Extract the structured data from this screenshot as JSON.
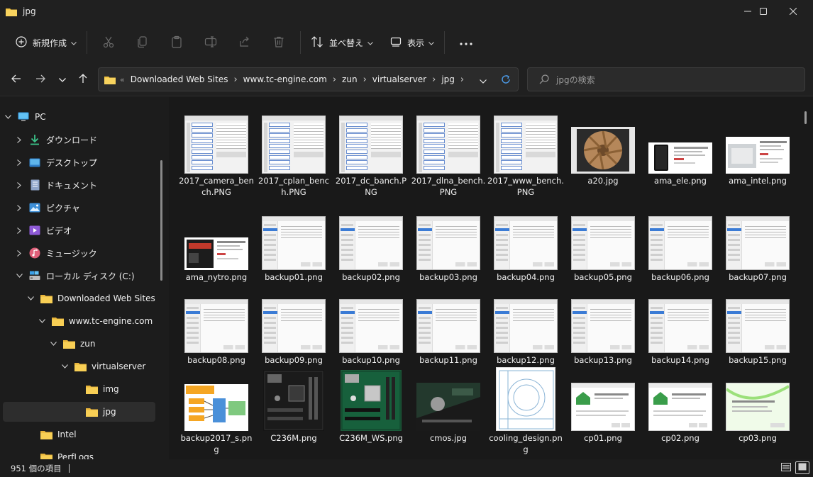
{
  "window": {
    "title": "jpg"
  },
  "toolbar": {
    "new_label": "新規作成",
    "sort_label": "並べ替え",
    "view_label": "表示"
  },
  "address": {
    "crumbs": [
      "Downloaded Web Sites",
      "www.tc-engine.com",
      "zun",
      "virtualserver",
      "jpg"
    ]
  },
  "search": {
    "placeholder": "jpgの検索"
  },
  "sidebar": {
    "items": [
      {
        "label": "PC",
        "icon": "pc-icon",
        "level": 0,
        "expanded": true
      },
      {
        "label": "ダウンロード",
        "icon": "download-icon",
        "level": 1,
        "expanded": false
      },
      {
        "label": "デスクトップ",
        "icon": "desktop-icon",
        "level": 1,
        "expanded": false
      },
      {
        "label": "ドキュメント",
        "icon": "document-icon",
        "level": 1,
        "expanded": false
      },
      {
        "label": "ピクチャ",
        "icon": "picture-icon",
        "level": 1,
        "expanded": false
      },
      {
        "label": "ビデオ",
        "icon": "video-icon",
        "level": 1,
        "expanded": false
      },
      {
        "label": "ミュージック",
        "icon": "music-icon",
        "level": 1,
        "expanded": false
      },
      {
        "label": "ローカル ディスク (C:)",
        "icon": "drive-icon",
        "level": 1,
        "expanded": true
      },
      {
        "label": "Downloaded Web Sites",
        "icon": "folder-icon",
        "level": 2,
        "expanded": true
      },
      {
        "label": "www.tc-engine.com",
        "icon": "folder-icon",
        "level": 3,
        "expanded": true
      },
      {
        "label": "zun",
        "icon": "folder-icon",
        "level": 4,
        "expanded": true
      },
      {
        "label": "virtualserver",
        "icon": "folder-icon",
        "level": 5,
        "expanded": true
      },
      {
        "label": "img",
        "icon": "folder-icon",
        "level": 6,
        "expanded": null
      },
      {
        "label": "jpg",
        "icon": "folder-icon",
        "level": 6,
        "expanded": null,
        "selected": true
      },
      {
        "label": "Intel",
        "icon": "folder-icon",
        "level": 2,
        "expanded": null
      },
      {
        "label": "PerfLogs",
        "icon": "folder-icon",
        "level": 2,
        "expanded": null
      }
    ]
  },
  "files": [
    {
      "name": "2017_camera_bench.PNG",
      "thumb": "bench"
    },
    {
      "name": "2017_cplan_bench.PNG",
      "thumb": "bench"
    },
    {
      "name": "2017_dc_banch.PNG",
      "thumb": "bench"
    },
    {
      "name": "2017_dlna_bench.PNG",
      "thumb": "bench"
    },
    {
      "name": "2017_www_bench.PNG",
      "thumb": "bench"
    },
    {
      "name": "a20.jpg",
      "thumb": "fan"
    },
    {
      "name": "ama_ele.png",
      "thumb": "product-ele"
    },
    {
      "name": "ama_intel.png",
      "thumb": "product-intel"
    },
    {
      "name": "ama_nytro.png",
      "thumb": "product-nytro"
    },
    {
      "name": "backup01.png",
      "thumb": "win"
    },
    {
      "name": "backup02.png",
      "thumb": "win"
    },
    {
      "name": "backup03.png",
      "thumb": "win"
    },
    {
      "name": "backup04.png",
      "thumb": "win"
    },
    {
      "name": "backup05.png",
      "thumb": "win"
    },
    {
      "name": "backup06.png",
      "thumb": "win"
    },
    {
      "name": "backup07.png",
      "thumb": "win"
    },
    {
      "name": "backup08.png",
      "thumb": "win"
    },
    {
      "name": "backup09.png",
      "thumb": "win"
    },
    {
      "name": "backup10.png",
      "thumb": "win"
    },
    {
      "name": "backup11.png",
      "thumb": "win"
    },
    {
      "name": "backup12.png",
      "thumb": "win"
    },
    {
      "name": "backup13.png",
      "thumb": "win"
    },
    {
      "name": "backup14.png",
      "thumb": "win"
    },
    {
      "name": "backup15.png",
      "thumb": "win"
    },
    {
      "name": "backup2017_s.png",
      "thumb": "diagram"
    },
    {
      "name": "C236M.png",
      "thumb": "board-dark"
    },
    {
      "name": "C236M_WS.png",
      "thumb": "board-green"
    },
    {
      "name": "cmos.jpg",
      "thumb": "cmos"
    },
    {
      "name": "cooling_design.png",
      "thumb": "cooling"
    },
    {
      "name": "cp01.png",
      "thumb": "green"
    },
    {
      "name": "cp02.png",
      "thumb": "green"
    },
    {
      "name": "cp03.png",
      "thumb": "green-bright"
    }
  ],
  "status": {
    "item_count": "951 個の項目"
  },
  "colors": {
    "folder": "#f4c542",
    "accent": "#4c9be8",
    "bg": "#1c1c1c"
  }
}
